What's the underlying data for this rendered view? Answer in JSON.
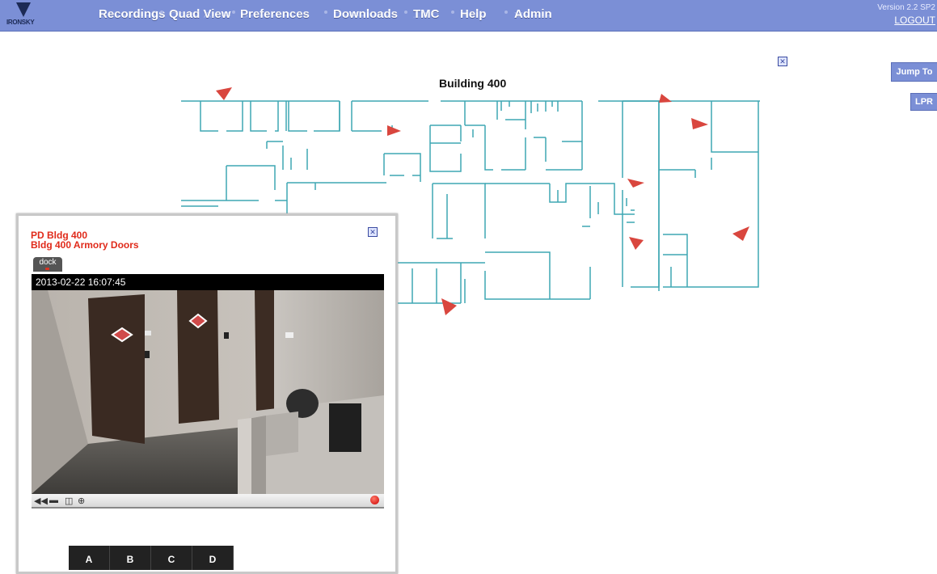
{
  "header": {
    "logo_text": "IRONSKY",
    "nav": [
      "Recordings",
      "Quad View",
      "Preferences",
      "Downloads",
      "TMC",
      "Help",
      "Admin"
    ],
    "version": "Version 2.2 SP2",
    "logout": "LOGOUT"
  },
  "side_buttons": {
    "jump_to": "Jump To",
    "lpr": "LPR"
  },
  "map": {
    "title": "Building 400",
    "close": "✕"
  },
  "camera_popup": {
    "site": "PD Bldg 400",
    "camera": "Bldg 400 Armory Doors",
    "dock": "dock",
    "timestamp": "2013-02-22 16:07:45",
    "close": "✕",
    "controls": {
      "rewind": "◀◀",
      "pause": "▬",
      "snapshot": "◫",
      "zoom": "⊕"
    },
    "tabs": [
      "A",
      "B",
      "C",
      "D"
    ]
  },
  "colors": {
    "nav_bar": "#7b8fd6",
    "walls": "#3fa7b3",
    "camera_marker": "#d9463e",
    "popup_title": "#e02a1a"
  },
  "icons": [
    "logo-icon",
    "close-icon",
    "rewind-icon",
    "stop-icon",
    "snapshot-icon",
    "zoom-icon",
    "record-icon",
    "camera-marker-icon"
  ]
}
